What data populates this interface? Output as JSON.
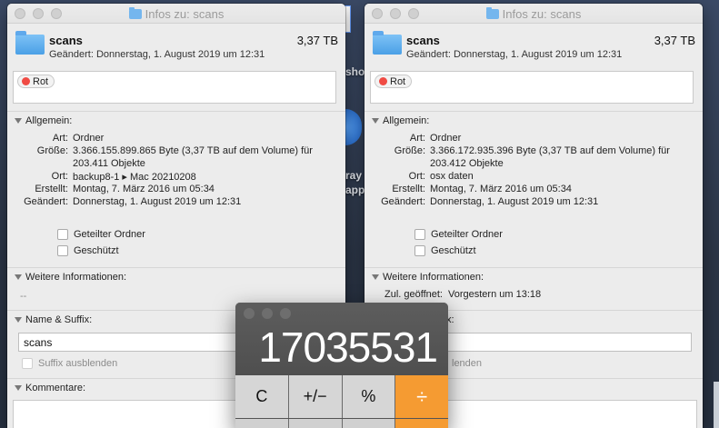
{
  "desktop": {
    "frag_sho": "sho",
    "frag_ray": "ray",
    "frag_app": "app"
  },
  "windows": [
    {
      "title": "Infos zu: scans",
      "name": "scans",
      "size": "3,37 TB",
      "modified": "Geändert: Donnerstag, 1. August 2019 um 12:31",
      "tag": "Rot",
      "general_header": "Allgemein:",
      "general": [
        {
          "label": "Art:",
          "value": "Ordner"
        },
        {
          "label": "Größe:",
          "value": "3.366.155.899.865 Byte (3,37 TB auf dem Volume) für",
          "value2": "203.411 Objekte"
        },
        {
          "label": "Ort:",
          "value": "backup8-1 ▸ Mac 20210208"
        },
        {
          "label": "Erstellt:",
          "value": "Montag, 7. März 2016 um 05:34"
        },
        {
          "label": "Geändert:",
          "value": "Donnerstag, 1. August 2019 um 12:31"
        }
      ],
      "shared_folder": "Geteilter Ordner",
      "locked": "Geschützt",
      "more_info_header": "Weitere Informationen:",
      "more_info_value": "--",
      "name_suffix_header": "Name & Suffix:",
      "name_field": "scans",
      "hide_suffix": "Suffix ausblenden",
      "comments_header": "Kommentare:"
    },
    {
      "title": "Infos zu: scans",
      "name": "scans",
      "size": "3,37 TB",
      "modified": "Geändert: Donnerstag, 1. August 2019 um 12:31",
      "tag": "Rot",
      "general_header": "Allgemein:",
      "general": [
        {
          "label": "Art:",
          "value": "Ordner"
        },
        {
          "label": "Größe:",
          "value": "3.366.172.935.396 Byte (3,37 TB auf dem Volume) für",
          "value2": "203.412 Objekte"
        },
        {
          "label": "Ort:",
          "value": "osx daten"
        },
        {
          "label": "Erstellt:",
          "value": "Montag, 7. März 2016 um 05:34"
        },
        {
          "label": "Geändert:",
          "value": "Donnerstag, 1. August 2019 um 12:31"
        }
      ],
      "shared_folder": "Geteilter Ordner",
      "locked": "Geschützt",
      "more_info_header": "Weitere Informationen:",
      "last_opened_label": "Zul. geöffnet:",
      "last_opened_value": "Vorgestern um 13:18",
      "name_suffix_header_fragment": "x:",
      "hide_suffix_fragment": "lenden"
    }
  ],
  "calculator": {
    "display": "17035531",
    "keys": [
      "C",
      "+/−",
      "%",
      "÷"
    ]
  },
  "colors": {
    "tag_red": "#f04b44",
    "operator_orange": "#f59b32",
    "folder_blue": "#4aa0e6"
  }
}
